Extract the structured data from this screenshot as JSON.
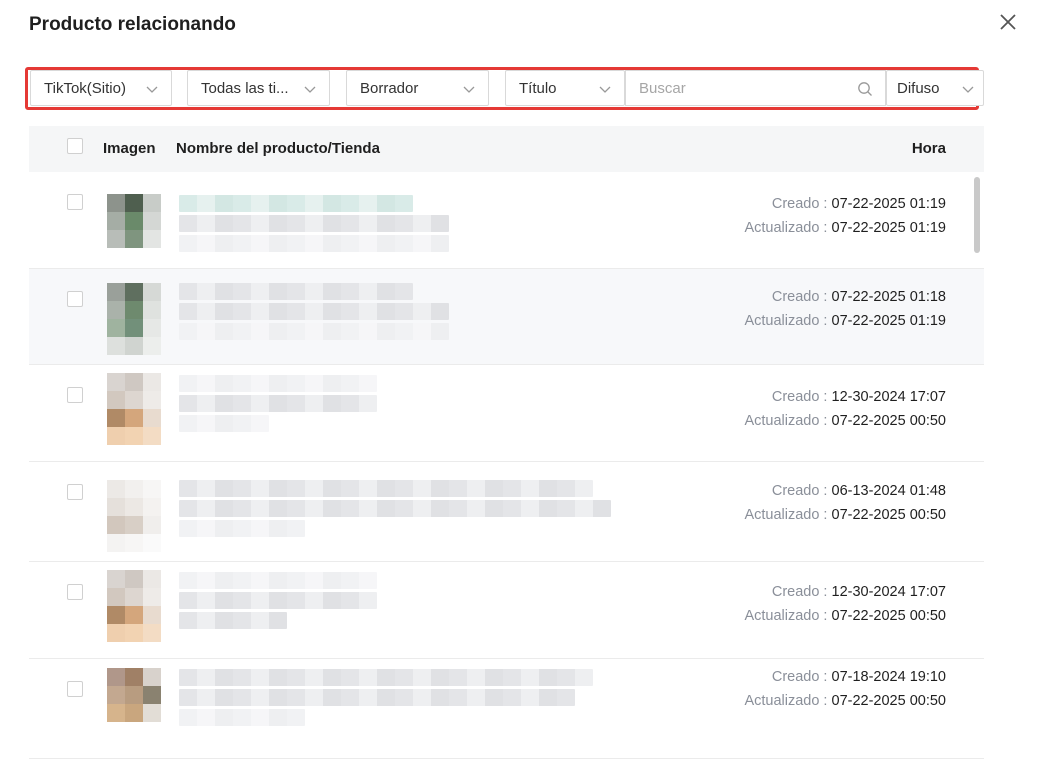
{
  "modal": {
    "title": "Producto relacionando"
  },
  "filters": {
    "platform": "TikTok(Sitio)",
    "type": "Todas las ti...",
    "status": "Borrador",
    "field": "Título",
    "search_placeholder": "Buscar",
    "match": "Difuso"
  },
  "table": {
    "headers": {
      "image": "Imagen",
      "name": "Nombre del producto/Tienda",
      "time": "Hora"
    },
    "created_label": "Creado",
    "updated_label": "Actualizado",
    "rows": [
      {
        "created": "07-22-2025 01:19",
        "updated": "07-22-2025 01:19"
      },
      {
        "created": "07-22-2025 01:18",
        "updated": "07-22-2025 01:19"
      },
      {
        "created": "12-30-2024 17:07",
        "updated": "07-22-2025 00:50"
      },
      {
        "created": "06-13-2024 01:48",
        "updated": "07-22-2025 00:50"
      },
      {
        "created": "12-30-2024 17:07",
        "updated": "07-22-2025 00:50"
      },
      {
        "created": "07-18-2024 19:10",
        "updated": "07-22-2025 00:50"
      }
    ]
  },
  "colors": {
    "highlight": "#e53935",
    "header_bg": "#f5f6f7",
    "muted_text": "#8a8f99"
  },
  "icons": [
    "close-icon",
    "chevron-down-icon",
    "search-icon"
  ]
}
